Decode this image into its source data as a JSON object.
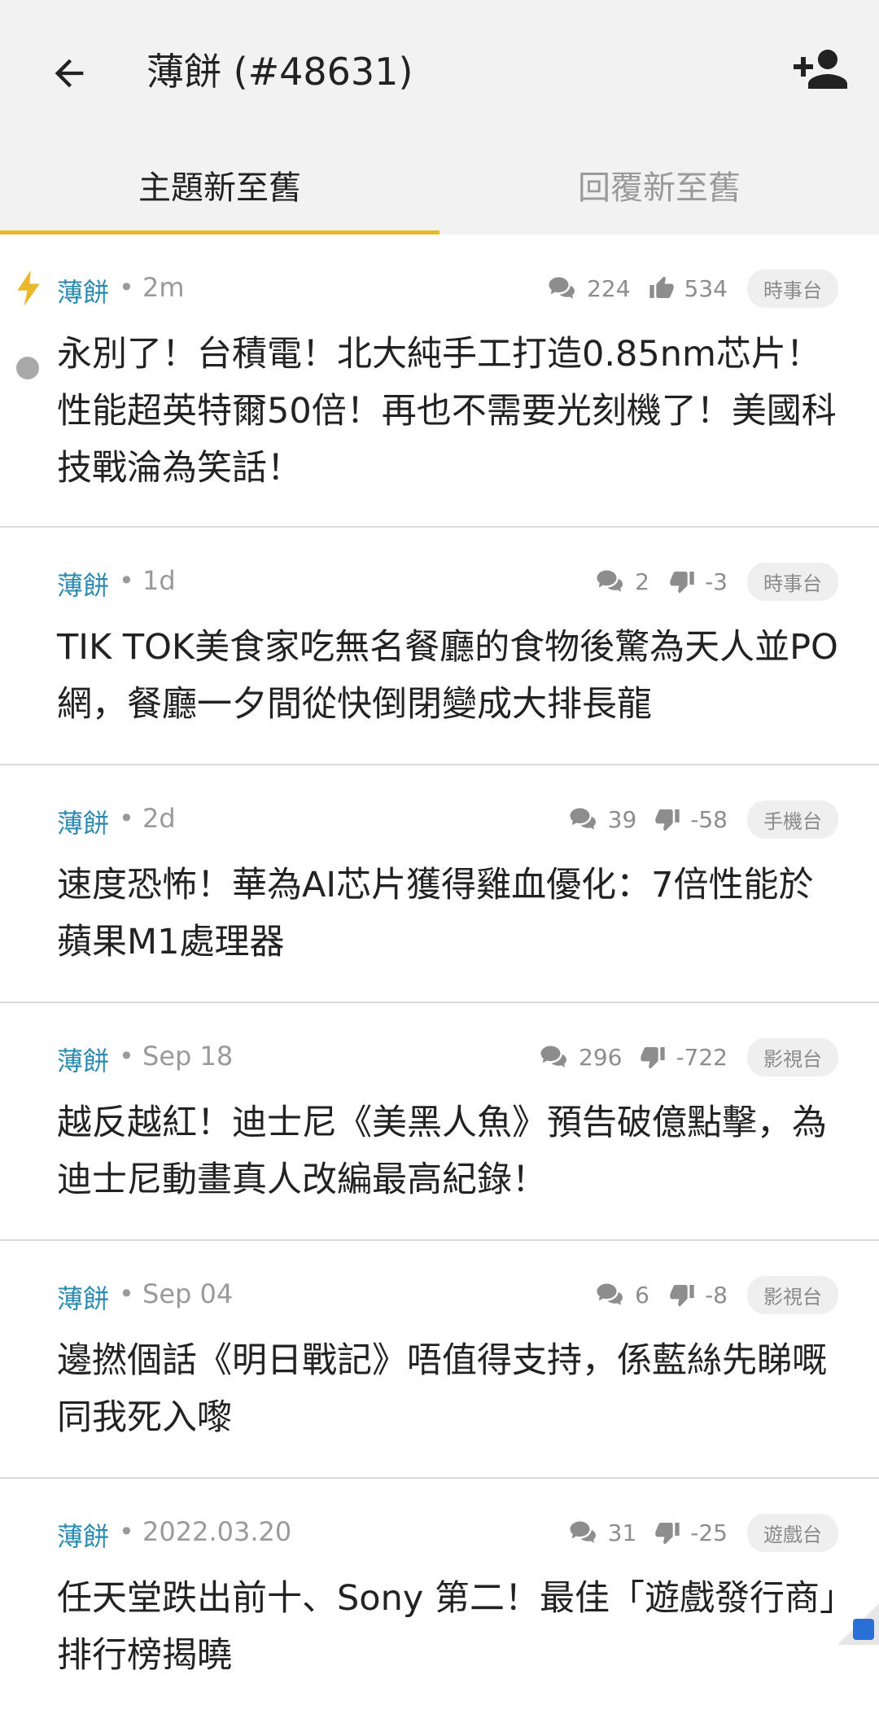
{
  "header": {
    "title": "薄餅 (#48631)",
    "back_icon": "arrow-left-icon",
    "add_user_icon": "person-add-icon"
  },
  "tabs": [
    {
      "label": "主題新至舊",
      "active": true
    },
    {
      "label": "回覆新至舊",
      "active": false
    }
  ],
  "colors": {
    "accent": "#e8b92a",
    "author": "#2a8ab0",
    "bolt": "#e8b92a"
  },
  "posts": [
    {
      "author": "薄餅",
      "time": "• 2m",
      "replies": "224",
      "vote_icon": "thumbs-up-icon",
      "votes": "534",
      "channel": "時事台",
      "new": true,
      "unread": true,
      "title": "永別了！台積電！北大純手工打造0.85nm芯片！性能超英特爾50倍！再也不需要光刻機了！美國科技戰淪為笑話！"
    },
    {
      "author": "薄餅",
      "time": "• 1d",
      "replies": "2",
      "vote_icon": "thumbs-down-icon",
      "votes": "-3",
      "channel": "時事台",
      "title": "TIK TOK美食家吃無名餐廳的食物後驚為天人並PO網，餐廳一夕間從快倒閉變成大排長龍"
    },
    {
      "author": "薄餅",
      "time": "• 2d",
      "replies": "39",
      "vote_icon": "thumbs-down-icon",
      "votes": "-58",
      "channel": "手機台",
      "title": "速度恐怖！華為AI芯片獲得雞血優化：7倍性能於蘋果M1處理器"
    },
    {
      "author": "薄餅",
      "time": "• Sep 18",
      "replies": "296",
      "vote_icon": "thumbs-down-icon",
      "votes": "-722",
      "channel": "影視台",
      "title": "越反越紅！迪士尼《美黑人魚》預告破億點擊，為迪士尼動畫真人改編最高紀錄！"
    },
    {
      "author": "薄餅",
      "time": "• Sep 04",
      "replies": "6",
      "vote_icon": "thumbs-down-icon",
      "votes": "-8",
      "channel": "影視台",
      "title": "邊撚個話《明日戰記》唔值得支持，係藍絲先睇嘅同我死入嚟"
    },
    {
      "author": "薄餅",
      "time": "• 2022.03.20",
      "replies": "31",
      "vote_icon": "thumbs-down-icon",
      "votes": "-25",
      "channel": "遊戲台",
      "title": "任天堂跌出前十、Sony 第二！最佳「遊戲發行商」排行榜揭曉"
    }
  ]
}
